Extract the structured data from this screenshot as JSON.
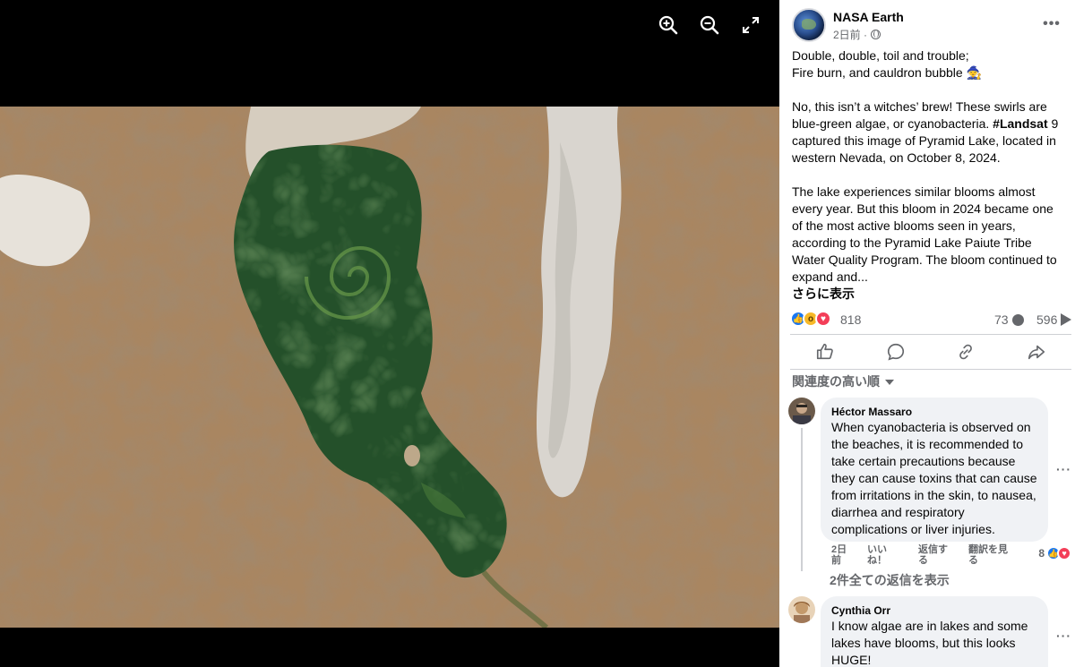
{
  "viewer": {
    "toolbar": {
      "zoom_in": "zoom-in-icon",
      "zoom_out": "zoom-out-icon",
      "fullscreen": "fullscreen-icon"
    }
  },
  "post": {
    "page_name": "NASA Earth",
    "time": "2日前 ·",
    "more": "•••",
    "text_lines": {
      "l1": "Double, double, toil and trouble;",
      "l2": "Fire burn, and cauldron bubble 🧙",
      "p2a": "No, this isn’t a witches’ brew! These swirls are blue-green algae, or cyanobacteria. ",
      "hashtag": "#Landsat",
      "p2b": " 9 captured this image of Pyramid Lake, located in western Nevada, on October 8, 2024.",
      "p3": "The lake experiences similar blooms almost every year. But this bloom in 2024 became one of the most active blooms seen in years, according to the Pyramid Lake Paiute Tribe Water Quality Program. The bloom continued to expand and..."
    },
    "see_more": "さらに表示",
    "reaction_count": "818",
    "comment_count": "73",
    "share_count": "596"
  },
  "sort_label": "関連度の高い順",
  "comments": [
    {
      "author": "Héctor Massaro",
      "text": "When cyanobacteria is observed on the beaches, it is recommended to take certain precautions because they can cause toxins that can cause from irritations in the skin, to nausea, diarrhea and respiratory complications or liver injuries.",
      "time": "2日\n前",
      "like": "いい\nね！",
      "reply": "返信す\nる",
      "translate": "翻訳を見\nる",
      "reactions": "8"
    },
    {
      "author": "Cynthia Orr",
      "text": "I know algae are in lakes and some lakes have blooms, but this looks HUGE!"
    }
  ],
  "view_replies": "2件全ての返信を表示",
  "colors": {
    "like_blue": "#1877f2",
    "love_red": "#f33e58",
    "text_gray": "#65676b",
    "bubble_gray": "#f0f2f5"
  }
}
